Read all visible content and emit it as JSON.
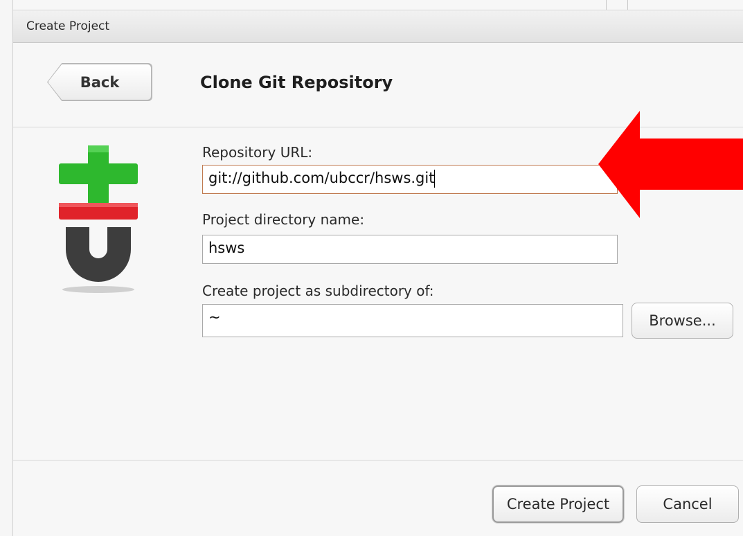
{
  "window": {
    "title": "Create Project"
  },
  "header": {
    "back_label": "Back",
    "page_title": "Clone Git Repository"
  },
  "form": {
    "repo_url": {
      "label": "Repository URL:",
      "value": "git://github.com/ubccr/hsws.git"
    },
    "project_dir": {
      "label": "Project directory name:",
      "value": "hsws"
    },
    "subdirectory": {
      "label": "Create project as subdirectory of:",
      "value": "~",
      "browse_label": "Browse..."
    }
  },
  "footer": {
    "create_label": "Create Project",
    "cancel_label": "Cancel"
  },
  "colors": {
    "annotation_arrow": "#ff0000",
    "git_plus": "#2eb82e",
    "git_minus": "#e0232a",
    "git_logo_dark": "#3d3d3d"
  },
  "icons": {
    "logo": "git-logo-icon",
    "annotation": "red-arrow-icon"
  }
}
